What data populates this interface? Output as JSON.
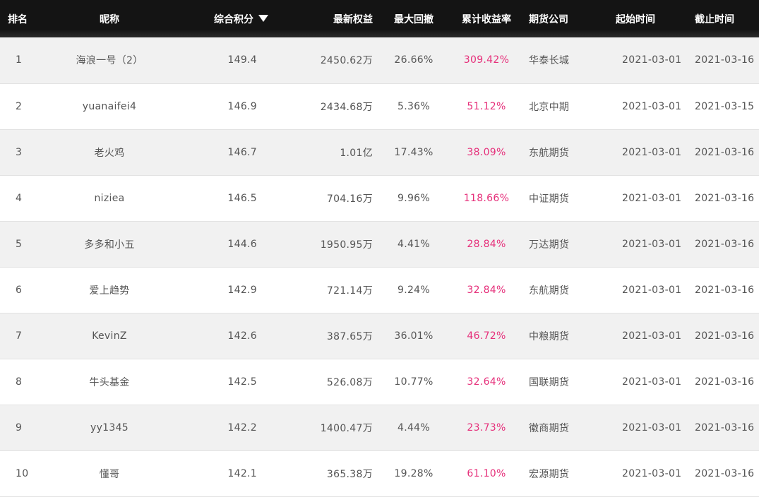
{
  "headers": {
    "rank": "排名",
    "nickname": "昵称",
    "score": "综合积分",
    "equity": "最新权益",
    "drawdown": "最大回撤",
    "return": "累计收益率",
    "company": "期货公司",
    "start": "起始时间",
    "end": "截止时间"
  },
  "sort_icon": "sort-desc-triangle",
  "colors": {
    "header_bg": "#141414",
    "header_text": "#ffffff",
    "row_alt_bg": "#f1f1f1",
    "return_text": "#e62f7a",
    "cell_text": "#555555"
  },
  "rows": [
    {
      "rank": "1",
      "nickname": "海浪一号（2）",
      "score": "149.4",
      "equity": "2450.62万",
      "drawdown": "26.66%",
      "return": "309.42%",
      "company": "华泰长城",
      "start": "2021-03-01",
      "end": "2021-03-16"
    },
    {
      "rank": "2",
      "nickname": "yuanaifei4",
      "score": "146.9",
      "equity": "2434.68万",
      "drawdown": "5.36%",
      "return": "51.12%",
      "company": "北京中期",
      "start": "2021-03-01",
      "end": "2021-03-15"
    },
    {
      "rank": "3",
      "nickname": "老火鸡",
      "score": "146.7",
      "equity": "1.01亿",
      "drawdown": "17.43%",
      "return": "38.09%",
      "company": "东航期货",
      "start": "2021-03-01",
      "end": "2021-03-16"
    },
    {
      "rank": "4",
      "nickname": "niziea",
      "score": "146.5",
      "equity": "704.16万",
      "drawdown": "9.96%",
      "return": "118.66%",
      "company": "中证期货",
      "start": "2021-03-01",
      "end": "2021-03-16"
    },
    {
      "rank": "5",
      "nickname": "多多和小五",
      "score": "144.6",
      "equity": "1950.95万",
      "drawdown": "4.41%",
      "return": "28.84%",
      "company": "万达期货",
      "start": "2021-03-01",
      "end": "2021-03-16"
    },
    {
      "rank": "6",
      "nickname": "爱上趋势",
      "score": "142.9",
      "equity": "721.14万",
      "drawdown": "9.24%",
      "return": "32.84%",
      "company": "东航期货",
      "start": "2021-03-01",
      "end": "2021-03-16"
    },
    {
      "rank": "7",
      "nickname": "KevinZ",
      "score": "142.6",
      "equity": "387.65万",
      "drawdown": "36.01%",
      "return": "46.72%",
      "company": "中粮期货",
      "start": "2021-03-01",
      "end": "2021-03-16"
    },
    {
      "rank": "8",
      "nickname": "牛头基金",
      "score": "142.5",
      "equity": "526.08万",
      "drawdown": "10.77%",
      "return": "32.64%",
      "company": "国联期货",
      "start": "2021-03-01",
      "end": "2021-03-16"
    },
    {
      "rank": "9",
      "nickname": "yy1345",
      "score": "142.2",
      "equity": "1400.47万",
      "drawdown": "4.44%",
      "return": "23.73%",
      "company": "徽商期货",
      "start": "2021-03-01",
      "end": "2021-03-16"
    },
    {
      "rank": "10",
      "nickname": "懂哥",
      "score": "142.1",
      "equity": "365.38万",
      "drawdown": "19.28%",
      "return": "61.10%",
      "company": "宏源期货",
      "start": "2021-03-01",
      "end": "2021-03-16"
    }
  ]
}
